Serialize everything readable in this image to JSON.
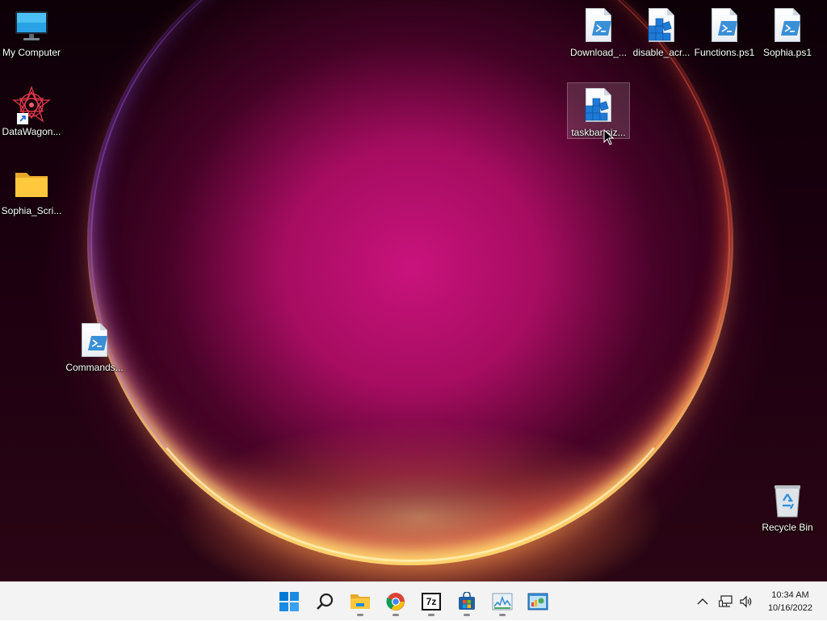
{
  "desktop": {
    "icons": {
      "my_computer": "My Computer",
      "datawagon": "DataWagon...",
      "sophia_scripts": "Sophia_Scri...",
      "commands": "Commands...",
      "download": "Download_...",
      "disable_acr": "disable_acr...",
      "functions": "Functions.ps1",
      "sophia_ps1": "Sophia.ps1",
      "taskbar_size": "taskbar siz...",
      "recycle_bin": "Recycle Bin"
    }
  },
  "taskbar": {
    "apps": [
      "start-icon",
      "search-icon",
      "file-explorer-icon",
      "chrome-icon",
      "7zip-icon",
      "microsoft-store-icon",
      "resource-monitor-icon",
      "control-panel-icon"
    ],
    "seven_zip_label": "7z",
    "clock": {
      "time": "10:34 AM",
      "date": "10/16/2022"
    }
  },
  "colors": {
    "taskbar_bg": "#f3f3f3",
    "accent_blue": "#0078d4",
    "folder_yellow": "#ffc83d"
  }
}
